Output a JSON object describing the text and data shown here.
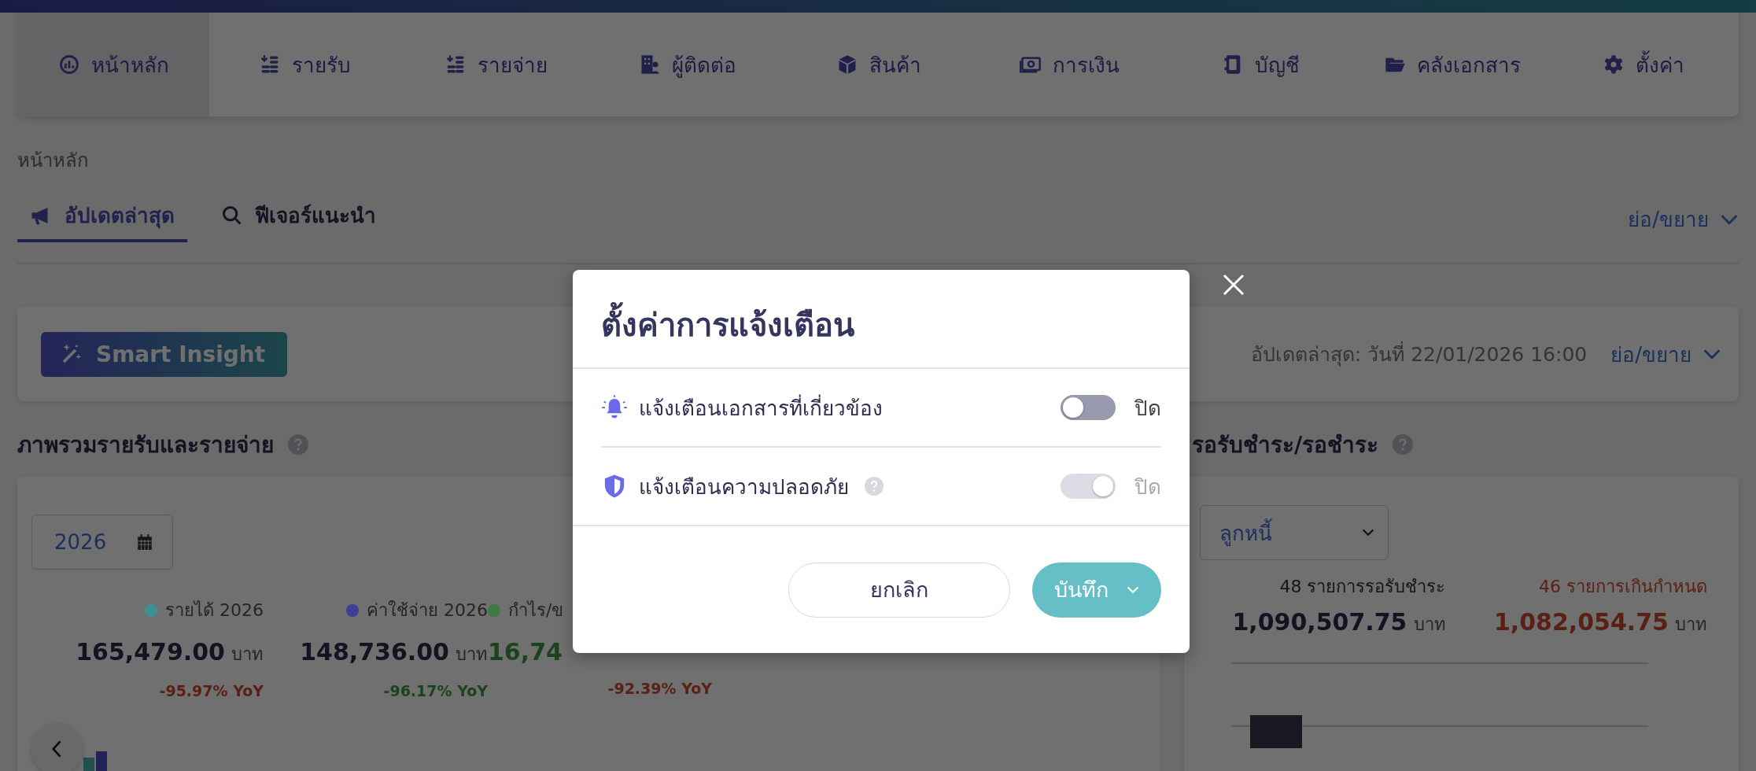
{
  "nav": {
    "items": [
      {
        "label": "หน้าหลัก",
        "selected": true
      },
      {
        "label": "รายรับ",
        "selected": false
      },
      {
        "label": "รายจ่าย",
        "selected": false
      },
      {
        "label": "ผู้ติดต่อ",
        "selected": false
      },
      {
        "label": "สินค้า",
        "selected": false
      },
      {
        "label": "การเงิน",
        "selected": false
      },
      {
        "label": "บัญชี",
        "selected": false
      },
      {
        "label": "คลังเอกสาร",
        "selected": false
      },
      {
        "label": "ตั้งค่า",
        "selected": false
      }
    ]
  },
  "breadcrumb": "หน้าหลัก",
  "tabs": [
    {
      "label": "อัปเดตล่าสุด",
      "selected": true
    },
    {
      "label": "ฟีเจอร์แนะนำ",
      "selected": false
    }
  ],
  "collapse_label": "ย่อ/ขยาย",
  "insight": {
    "button": "Smart Insight",
    "updated": "อัปเดตล่าสุด: วันที่ 22/01/2026 16:00",
    "collapse_label": "ย่อ/ขยาย"
  },
  "overview": {
    "title": "ภาพรวมรายรับและรายจ่าย",
    "year": "2026",
    "stats": [
      {
        "label": "รายได้ 2026",
        "color": "#3d8f94",
        "amount": "165,479.00",
        "unit": "บาท",
        "change": "-95.97% YoY",
        "positive": false,
        "highlight": false
      },
      {
        "label": "ค่าใช้จ่าย 2026",
        "color": "#3f3f99",
        "amount": "148,736.00",
        "unit": "บาท",
        "change": "-96.17% YoY",
        "positive": true,
        "highlight": false
      },
      {
        "label": "กำไร/ข",
        "color": "#3d7a44",
        "amount": "16,74",
        "change": "-92.39% YoY",
        "positive": false,
        "highlight": true
      }
    ]
  },
  "receivables": {
    "title": "รอรับชำระ/รอชำระ",
    "select": "ลูกหนี้",
    "stats": [
      {
        "label": "48 รายการรอรับชำระ",
        "amount": "1,090,507.75",
        "unit": "บาท",
        "overdue": false
      },
      {
        "label": "46 รายการเกินกำหนด",
        "amount": "1,082,054.75",
        "unit": "บาท",
        "overdue": true
      }
    ]
  },
  "modal": {
    "title": "ตั้งค่าการแจ้งเตือน",
    "rows": [
      {
        "label": "แจ้งเตือนเอกสารที่เกี่ยวข้อง",
        "help": false,
        "on": false,
        "disabled": false,
        "state_label": "ปิด"
      },
      {
        "label": "แจ้งเตือนความปลอดภัย",
        "help": true,
        "on": true,
        "disabled": true,
        "state_label": "ปิด"
      }
    ],
    "cancel": "ยกเลิก",
    "save": "บันทึก"
  }
}
